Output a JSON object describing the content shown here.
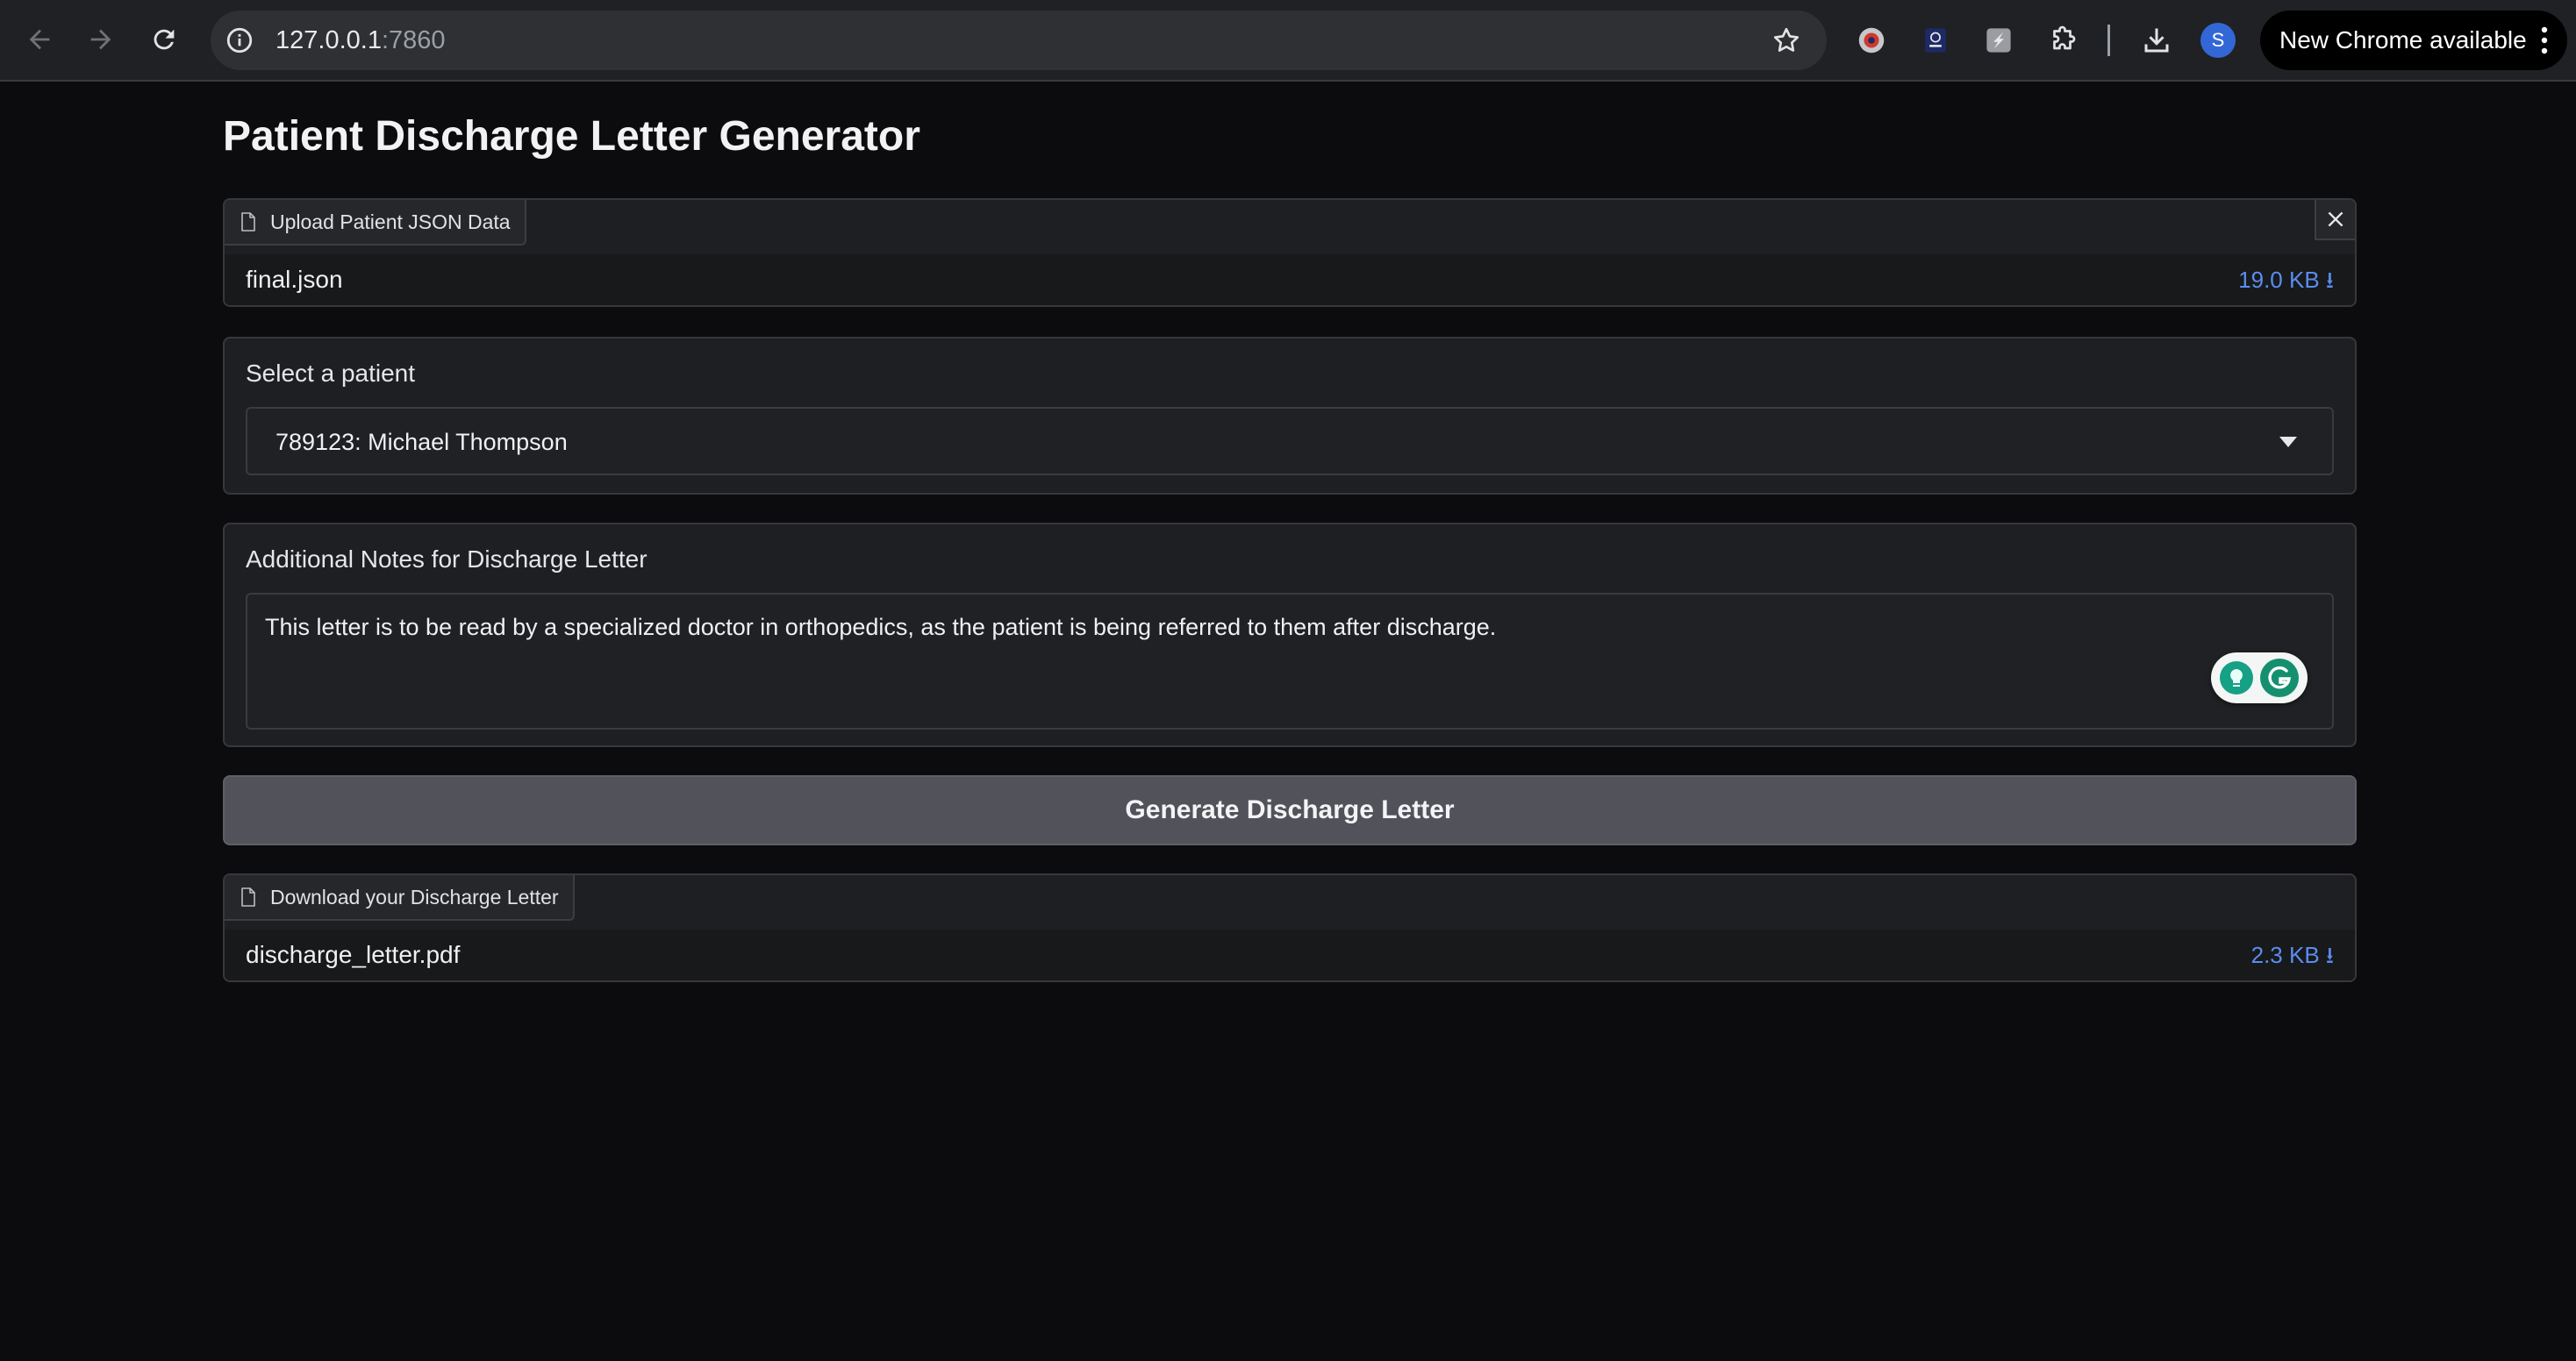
{
  "browser": {
    "url_host": "127.0.0.1",
    "url_port": ":7860",
    "avatar_letter": "S",
    "update_label": "New Chrome available"
  },
  "app": {
    "title": "Patient Discharge Letter Generator",
    "upload": {
      "label": "Upload Patient JSON Data",
      "file_name": "final.json",
      "file_size": "19.0 KB ⭳"
    },
    "patient_select": {
      "label": "Select a patient",
      "value": "789123: Michael Thompson"
    },
    "notes": {
      "label": "Additional Notes for Discharge Letter",
      "value": "This letter is to be read by a specialized doctor in orthopedics, as the patient is being referred to them after discharge."
    },
    "generate_button": "Generate Discharge Letter",
    "download": {
      "label": "Download your Discharge Letter",
      "file_name": "discharge_letter.pdf",
      "file_size": "2.3 KB ⭳"
    }
  },
  "colors": {
    "accent_link": "#5b8cf0",
    "button_bg": "#52525b",
    "page_bg": "#0c0c0e"
  },
  "icons": [
    "back-icon",
    "forward-icon",
    "reload-icon",
    "info-icon",
    "star-icon",
    "extension-icon",
    "download-icon",
    "file-icon",
    "close-icon",
    "chevron-down-icon",
    "grammarly-icon"
  ]
}
